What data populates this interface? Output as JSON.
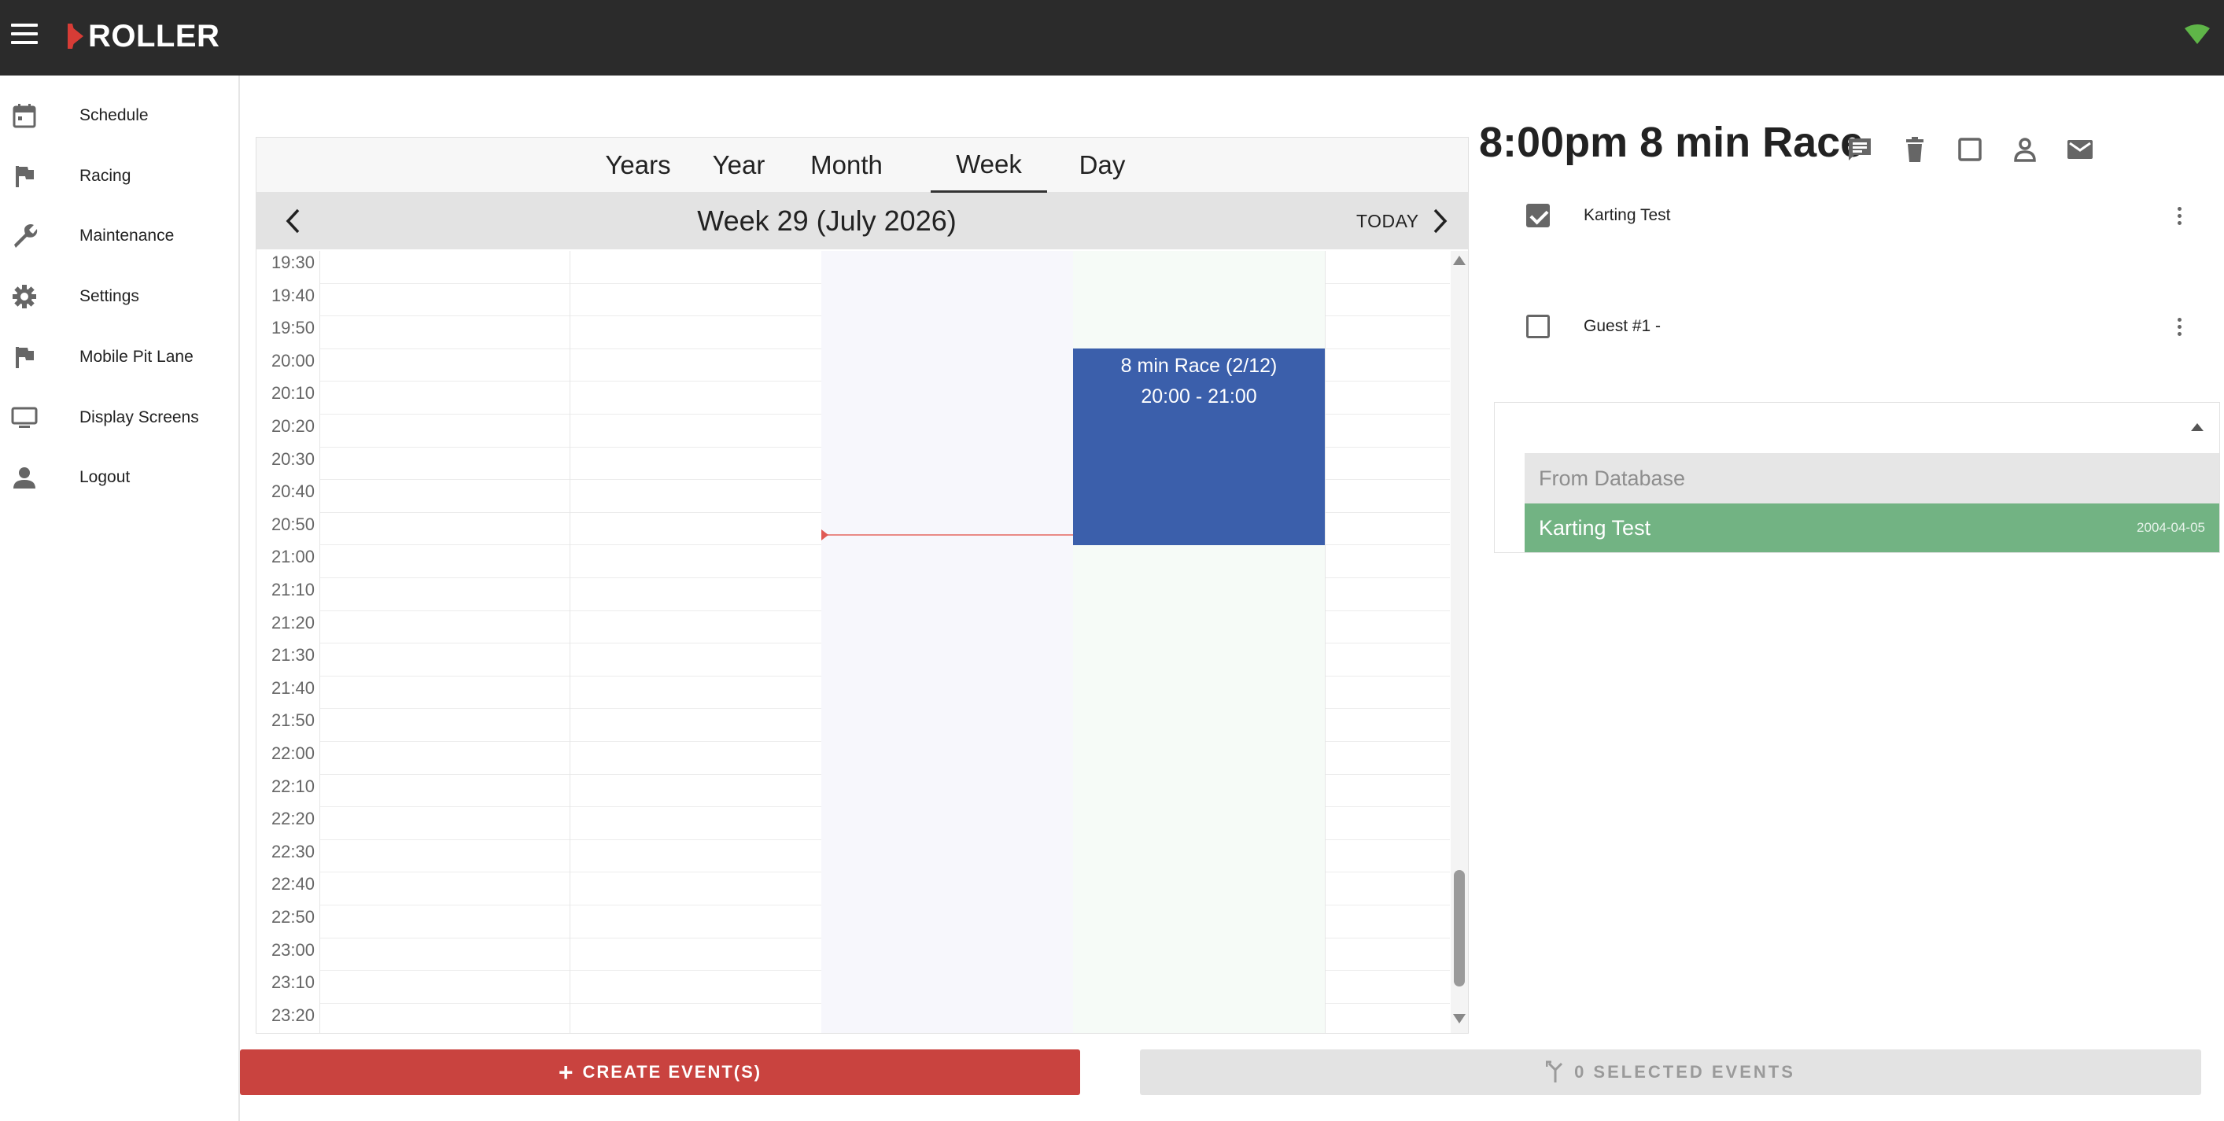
{
  "app": {
    "brand": "ROLLER",
    "brand_color": "#d73c36",
    "topbar_color": "#2b2b2b"
  },
  "sidebar": {
    "items": [
      {
        "label": "Schedule",
        "icon": "calendar-icon"
      },
      {
        "label": "Racing",
        "icon": "flag-icon"
      },
      {
        "label": "Maintenance",
        "icon": "wrench-icon"
      },
      {
        "label": "Settings",
        "icon": "gear-icon"
      },
      {
        "label": "Mobile Pit Lane",
        "icon": "flag-icon"
      },
      {
        "label": "Display Screens",
        "icon": "monitor-icon"
      },
      {
        "label": "Logout",
        "icon": "person-icon"
      }
    ]
  },
  "calendar": {
    "tabs": [
      "Years",
      "Year",
      "Month",
      "Week",
      "Day"
    ],
    "active_tab": "Week",
    "week_title": "Week 29 (July 2026)",
    "today_label": "TODAY",
    "times": [
      "19:30",
      "19:40",
      "19:50",
      "20:00",
      "20:10",
      "20:20",
      "20:30",
      "20:40",
      "20:50",
      "21:00",
      "21:10",
      "21:20",
      "21:30",
      "21:40",
      "21:50",
      "22:00",
      "22:10",
      "22:20",
      "22:30",
      "22:40",
      "22:50",
      "23:00",
      "23:10",
      "23:20"
    ],
    "event": {
      "title": "8 min Race (2/12)",
      "time": "20:00 - 21:00",
      "color": "#3b5fab"
    }
  },
  "detail": {
    "title": "8:00pm 8 min Race",
    "actions": [
      "comment-icon",
      "delete-icon",
      "checkbox-icon",
      "person-icon",
      "mail-icon"
    ],
    "participants": [
      {
        "name": "Karting Test",
        "checked": true
      },
      {
        "name": "Guest #1 -",
        "checked": false
      }
    ],
    "search": {
      "value": "",
      "group_header": "From Database",
      "option_name": "Karting Test",
      "option_date": "2004-04-05",
      "option_color": "#72b383"
    }
  },
  "buttons": {
    "create": "CREATE EVENT(S)",
    "selected": "0 SELECTED EVENTS",
    "create_color": "#c9433f"
  }
}
